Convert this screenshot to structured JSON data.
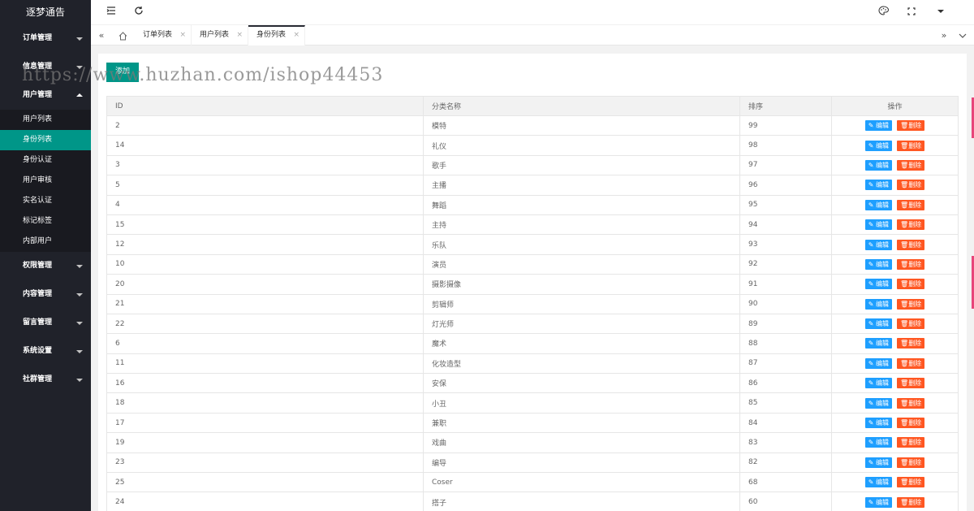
{
  "sidebar": {
    "logo": "逐梦通告",
    "groups": [
      {
        "label": "订单管理",
        "expanded": false
      },
      {
        "label": "信息管理",
        "expanded": false
      },
      {
        "label": "用户管理",
        "expanded": true
      },
      {
        "label": "权限管理",
        "expanded": false
      },
      {
        "label": "内容管理",
        "expanded": false
      },
      {
        "label": "留言管理",
        "expanded": false
      },
      {
        "label": "系统设置",
        "expanded": false
      },
      {
        "label": "社群管理",
        "expanded": false
      }
    ],
    "user_items": [
      "用户列表",
      "身份列表",
      "身份认证",
      "用户审核",
      "实名认证",
      "标记标签",
      "内部用户"
    ],
    "active_item": "身份列表"
  },
  "tabs": [
    {
      "label": "订单列表",
      "active": false
    },
    {
      "label": "用户列表",
      "active": false
    },
    {
      "label": "身份列表",
      "active": true
    }
  ],
  "toolbar": {
    "add_label": "添加"
  },
  "watermark": "https://www.huzhan.com/ishop44453",
  "table": {
    "headers": [
      "ID",
      "分类名称",
      "排序",
      "操作"
    ],
    "edit_label": "编辑",
    "delete_label": "删除",
    "rows": [
      {
        "id": "2",
        "name": "模特",
        "sort": "99"
      },
      {
        "id": "14",
        "name": "礼仪",
        "sort": "98"
      },
      {
        "id": "3",
        "name": "歌手",
        "sort": "97"
      },
      {
        "id": "5",
        "name": "主播",
        "sort": "96"
      },
      {
        "id": "4",
        "name": "舞蹈",
        "sort": "95"
      },
      {
        "id": "15",
        "name": "主持",
        "sort": "94"
      },
      {
        "id": "12",
        "name": "乐队",
        "sort": "93"
      },
      {
        "id": "10",
        "name": "演员",
        "sort": "92"
      },
      {
        "id": "20",
        "name": "摄影摄像",
        "sort": "91"
      },
      {
        "id": "21",
        "name": "剪辑师",
        "sort": "90"
      },
      {
        "id": "22",
        "name": "灯光师",
        "sort": "89"
      },
      {
        "id": "6",
        "name": "魔术",
        "sort": "88"
      },
      {
        "id": "11",
        "name": "化妆造型",
        "sort": "87"
      },
      {
        "id": "16",
        "name": "安保",
        "sort": "86"
      },
      {
        "id": "18",
        "name": "小丑",
        "sort": "85"
      },
      {
        "id": "17",
        "name": "兼职",
        "sort": "84"
      },
      {
        "id": "19",
        "name": "戏曲",
        "sort": "83"
      },
      {
        "id": "23",
        "name": "编导",
        "sort": "82"
      },
      {
        "id": "25",
        "name": "Coser",
        "sort": "68"
      },
      {
        "id": "24",
        "name": "搭子",
        "sort": "60"
      }
    ]
  }
}
